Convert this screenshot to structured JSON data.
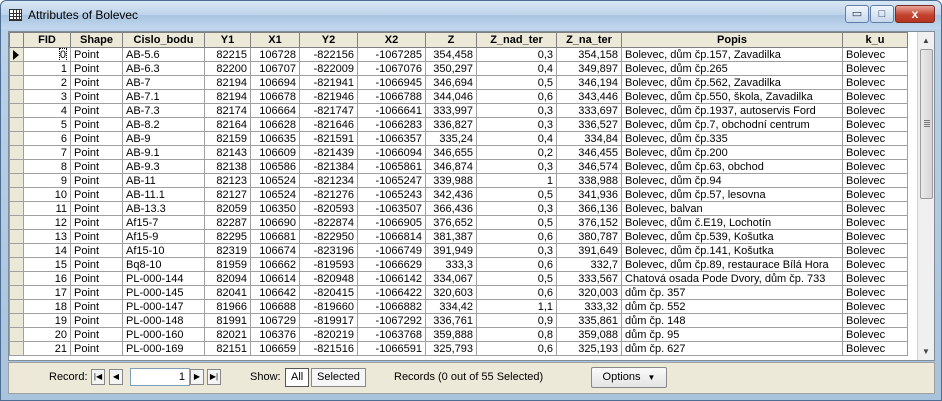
{
  "window": {
    "title": "Attributes of Bolevec",
    "controls": {
      "minimize": "▭",
      "maximize": "□",
      "close": "x"
    }
  },
  "table": {
    "columns": [
      "FID",
      "Shape",
      "Cislo_bodu",
      "Y1",
      "X1",
      "Y2",
      "X2",
      "Z",
      "Z_nad_ter",
      "Z_na_ter",
      "Popis",
      "k_u"
    ],
    "rows": [
      [
        "0",
        "Point",
        "AB-5.6",
        "82215",
        "106728",
        "-822156",
        "-1067285",
        "354,458",
        "0,3",
        "354,158",
        "Bolevec, dům čp.157, Zavadilka",
        "Bolevec"
      ],
      [
        "1",
        "Point",
        "AB-6.3",
        "82200",
        "106707",
        "-822009",
        "-1067076",
        "350,297",
        "0,4",
        "349,897",
        "Bolevec, dům čp.265",
        "Bolevec"
      ],
      [
        "2",
        "Point",
        "AB-7",
        "82194",
        "106694",
        "-821941",
        "-1066945",
        "346,694",
        "0,5",
        "346,194",
        "Bolevec, dům čp.562, Zavadilka",
        "Bolevec"
      ],
      [
        "3",
        "Point",
        "AB-7.1",
        "82194",
        "106678",
        "-821946",
        "-1066788",
        "344,046",
        "0,6",
        "343,446",
        "Bolevec, dům čp.550, škola, Zavadilka",
        "Bolevec"
      ],
      [
        "4",
        "Point",
        "AB-7.3",
        "82174",
        "106664",
        "-821747",
        "-1066641",
        "333,997",
        "0,3",
        "333,697",
        "Bolevec, dům čp.1937, autoservis Ford",
        "Bolevec"
      ],
      [
        "5",
        "Point",
        "AB-8.2",
        "82164",
        "106628",
        "-821646",
        "-1066283",
        "336,827",
        "0,3",
        "336,527",
        "Bolevec, dům čp.7, obchodní centrum",
        "Bolevec"
      ],
      [
        "6",
        "Point",
        "AB-9",
        "82159",
        "106635",
        "-821591",
        "-1066357",
        "335,24",
        "0,4",
        "334,84",
        "Bolevec, dům čp.335",
        "Bolevec"
      ],
      [
        "7",
        "Point",
        "AB-9.1",
        "82143",
        "106609",
        "-821439",
        "-1066094",
        "346,655",
        "0,2",
        "346,455",
        "Bolevec, dům čp.200",
        "Bolevec"
      ],
      [
        "8",
        "Point",
        "AB-9.3",
        "82138",
        "106586",
        "-821384",
        "-1065861",
        "346,874",
        "0,3",
        "346,574",
        "Bolevec, dům čp.63, obchod",
        "Bolevec"
      ],
      [
        "9",
        "Point",
        "AB-11",
        "82123",
        "106524",
        "-821234",
        "-1065247",
        "339,988",
        "1",
        "338,988",
        "Bolevec, dům čp.94",
        "Bolevec"
      ],
      [
        "10",
        "Point",
        "AB-11.1",
        "82127",
        "106524",
        "-821276",
        "-1065243",
        "342,436",
        "0,5",
        "341,936",
        "Bolevec, dům čp.57, lesovna",
        "Bolevec"
      ],
      [
        "11",
        "Point",
        "AB-13.3",
        "82059",
        "106350",
        "-820593",
        "-1063507",
        "366,436",
        "0,3",
        "366,136",
        "Bolevec, balvan",
        "Bolevec"
      ],
      [
        "12",
        "Point",
        "Af15-7",
        "82287",
        "106690",
        "-822874",
        "-1066905",
        "376,652",
        "0,5",
        "376,152",
        "Bolevec, dům č.E19, Lochotín",
        "Bolevec"
      ],
      [
        "13",
        "Point",
        "Af15-9",
        "82295",
        "106681",
        "-822950",
        "-1066814",
        "381,387",
        "0,6",
        "380,787",
        "Bolevec, dům čp.539, Košutka",
        "Bolevec"
      ],
      [
        "14",
        "Point",
        "Af15-10",
        "82319",
        "106674",
        "-823196",
        "-1066749",
        "391,949",
        "0,3",
        "391,649",
        "Bolevec, dům čp.141, Košutka",
        "Bolevec"
      ],
      [
        "15",
        "Point",
        "Bq8-10",
        "81959",
        "106662",
        "-819593",
        "-1066629",
        "333,3",
        "0,6",
        "332,7",
        "Bolevec, dům čp.89, restaurace Bílá Hora",
        "Bolevec"
      ],
      [
        "16",
        "Point",
        "PL-000-144",
        "82094",
        "106614",
        "-820948",
        "-1066142",
        "334,067",
        "0,5",
        "333,567",
        "Chatová osada Pode Dvory, dům čp. 733",
        "Bolevec"
      ],
      [
        "17",
        "Point",
        "PL-000-145",
        "82041",
        "106642",
        "-820415",
        "-1066422",
        "320,603",
        "0,6",
        "320,003",
        "dům čp. 357",
        "Bolevec"
      ],
      [
        "18",
        "Point",
        "PL-000-147",
        "81966",
        "106688",
        "-819660",
        "-1066882",
        "334,42",
        "1,1",
        "333,32",
        "dům čp. 552",
        "Bolevec"
      ],
      [
        "19",
        "Point",
        "PL-000-148",
        "81991",
        "106729",
        "-819917",
        "-1067292",
        "336,761",
        "0,9",
        "335,861",
        "dům čp. 148",
        "Bolevec"
      ],
      [
        "20",
        "Point",
        "PL-000-160",
        "82021",
        "106376",
        "-820219",
        "-1063768",
        "359,888",
        "0,8",
        "359,088",
        "dům čp. 95",
        "Bolevec"
      ],
      [
        "21",
        "Point",
        "PL-000-169",
        "82151",
        "106659",
        "-821516",
        "-1066591",
        "325,793",
        "0,6",
        "325,193",
        "dům čp. 627",
        "Bolevec"
      ]
    ]
  },
  "statusbar": {
    "record_label": "Record:",
    "record_value": "1",
    "show_label": "Show:",
    "all_label": "All",
    "selected_label": "Selected",
    "records_text": "Records (0 out of 55 Selected)",
    "options_label": "Options"
  }
}
